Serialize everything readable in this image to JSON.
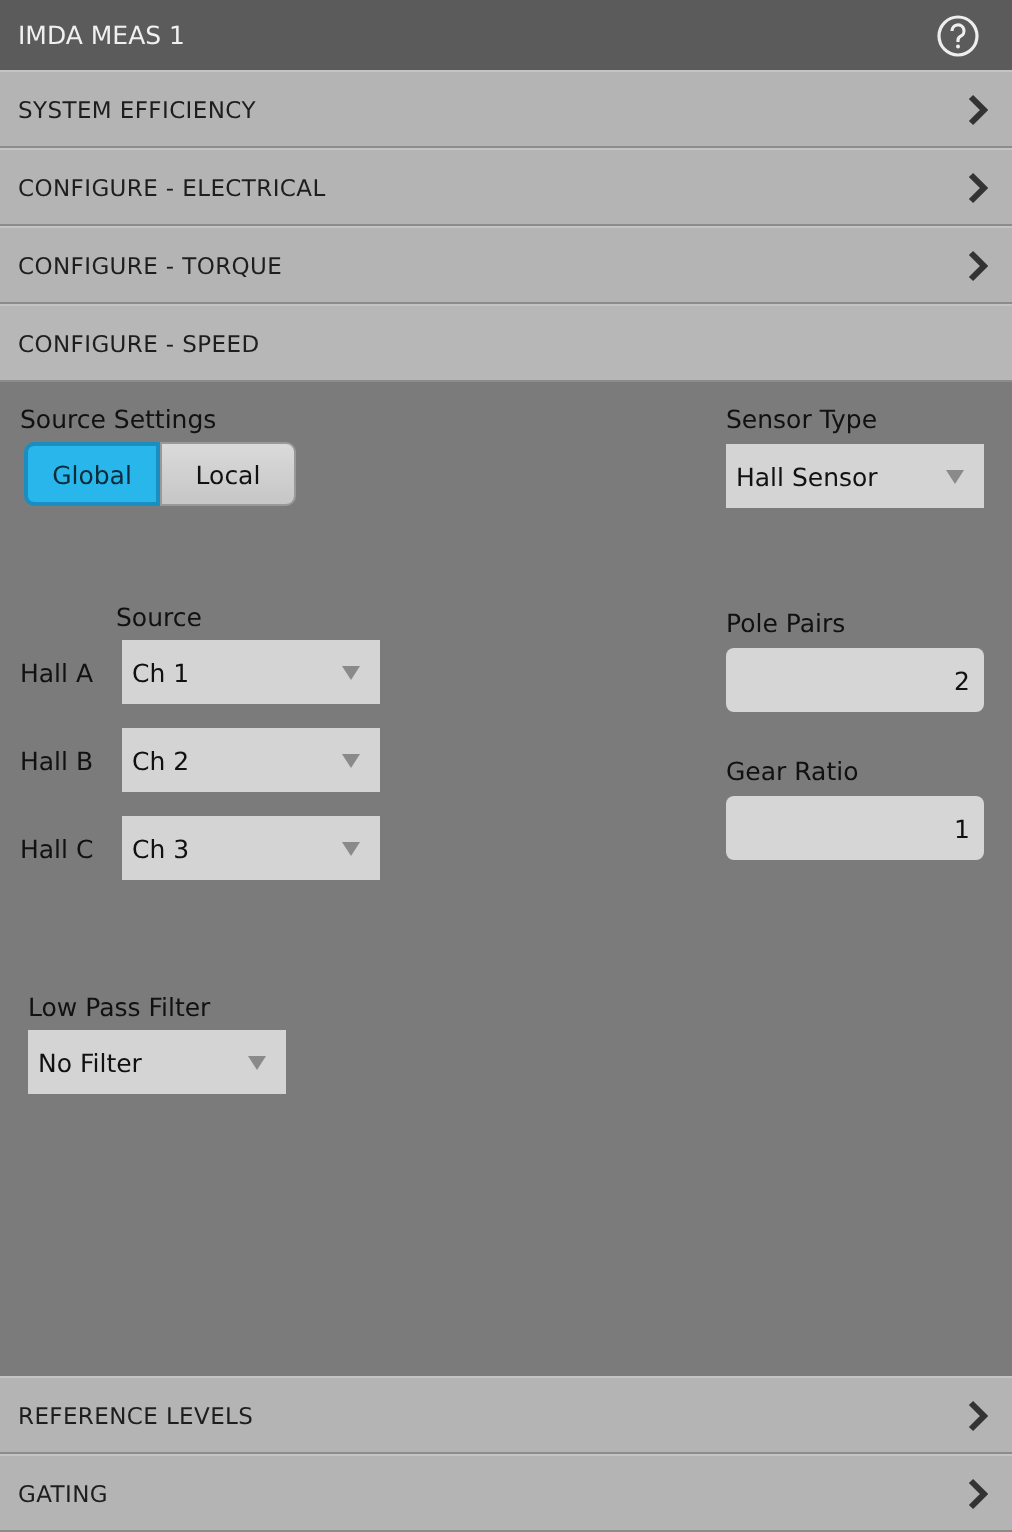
{
  "window": {
    "title": "IMDA MEAS 1"
  },
  "sections_top": [
    {
      "label": "SYSTEM EFFICIENCY",
      "expanded": false
    },
    {
      "label": "CONFIGURE - ELECTRICAL",
      "expanded": false
    },
    {
      "label": "CONFIGURE - TORQUE",
      "expanded": false
    },
    {
      "label": "CONFIGURE - SPEED",
      "expanded": true
    }
  ],
  "speed_config": {
    "source_settings": {
      "label": "Source Settings",
      "options": [
        {
          "label": "Global",
          "selected": true
        },
        {
          "label": "Local",
          "selected": false
        }
      ]
    },
    "source_header": "Source",
    "hall_sources": [
      {
        "label": "Hall A",
        "value": "Ch 1"
      },
      {
        "label": "Hall B",
        "value": "Ch 2"
      },
      {
        "label": "Hall C",
        "value": "Ch 3"
      }
    ],
    "low_pass_filter": {
      "label": "Low Pass Filter",
      "value": "No Filter"
    },
    "sensor_type": {
      "label": "Sensor Type",
      "value": "Hall Sensor"
    },
    "pole_pairs": {
      "label": "Pole Pairs",
      "value": "2"
    },
    "gear_ratio": {
      "label": "Gear Ratio",
      "value": "1"
    }
  },
  "sections_bottom": [
    {
      "label": "REFERENCE LEVELS",
      "expanded": false
    },
    {
      "label": "GATING",
      "expanded": false
    }
  ]
}
